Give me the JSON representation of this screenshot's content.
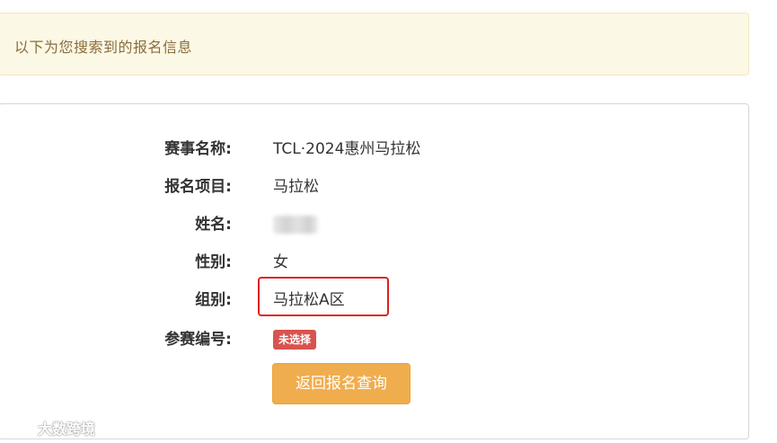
{
  "alert": {
    "text": "以下为您搜索到的报名信息"
  },
  "info": {
    "event_name_label": "赛事名称:",
    "event_name_value": "TCL·2024惠州马拉松",
    "project_label": "报名项目:",
    "project_value": "马拉松",
    "name_label": "姓名:",
    "name_value": "",
    "gender_label": "性别:",
    "gender_value": "女",
    "group_label": "组别:",
    "group_value": "马拉松A区",
    "bib_label": "参赛编号:",
    "bib_badge": "未选择"
  },
  "actions": {
    "back_button": "返回报名查询"
  },
  "watermark": {
    "text": "大数跨境"
  },
  "colors": {
    "alert_bg": "#fcf8e6",
    "alert_text": "#8a6d3b",
    "badge_bg": "#d9534f",
    "button_bg": "#f0ad4e",
    "highlight_border": "#e02020"
  }
}
